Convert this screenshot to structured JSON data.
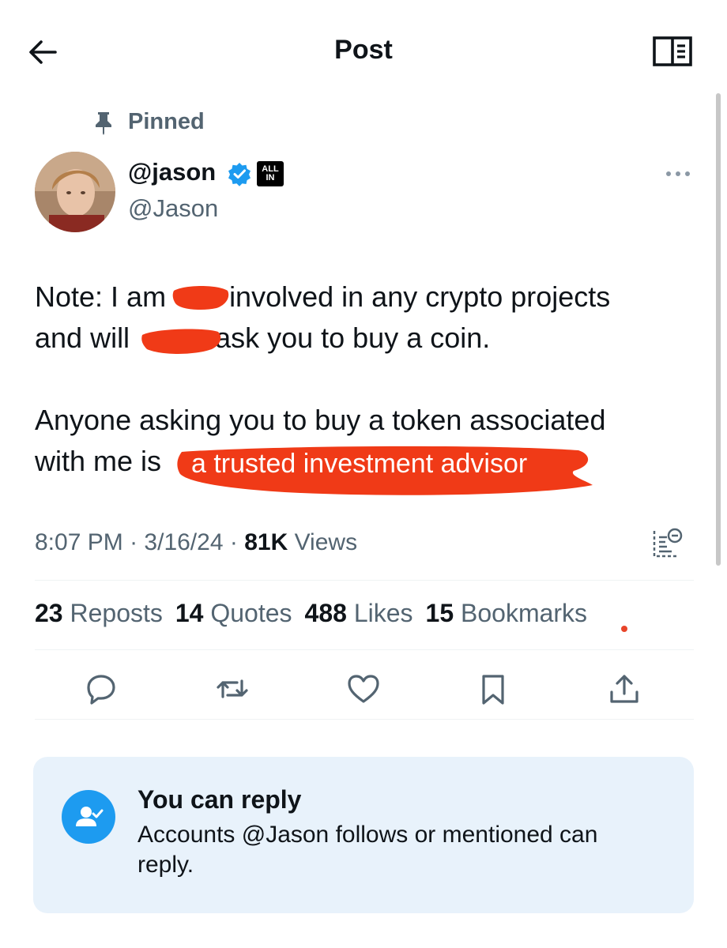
{
  "header": {
    "title": "Post"
  },
  "pinned": {
    "label": "Pinned"
  },
  "author": {
    "display_name": "@jason",
    "handle": "@Jason",
    "affiliate_badge": "ALL IN",
    "verified": true
  },
  "tweet": {
    "line1_part1": "Note: I am",
    "line1_part2": "involved in any crypto projects",
    "line2_part1": "and will",
    "line2_part2": "ask you to buy a coin.",
    "line3": "Anyone asking you to buy a token associated",
    "line4_part1": "with me is",
    "highlight": "a trusted investment advisor"
  },
  "meta": {
    "time": "8:07 PM",
    "separator": "·",
    "date": "3/16/24",
    "views_count": "81K",
    "views_label": "Views"
  },
  "stats": {
    "reposts_count": "23",
    "reposts_label": "Reposts",
    "quotes_count": "14",
    "quotes_label": "Quotes",
    "likes_count": "488",
    "likes_label": "Likes",
    "bookmarks_count": "15",
    "bookmarks_label": "Bookmarks"
  },
  "reply_card": {
    "title": "You can reply",
    "description": "Accounts @Jason follows or mentioned can reply."
  },
  "colors": {
    "text_primary": "#0f1419",
    "text_secondary": "#536471",
    "accent_blue": "#1d9bf0",
    "scribble_red": "#f03a17",
    "card_bg": "#e8f2fb"
  },
  "icons": [
    "back-arrow-icon",
    "reader-mode-icon",
    "pin-icon",
    "verified-icon",
    "more-icon",
    "analytics-icon",
    "reply-icon",
    "repost-icon",
    "like-icon",
    "bookmark-icon",
    "share-icon",
    "reply-permission-icon"
  ]
}
